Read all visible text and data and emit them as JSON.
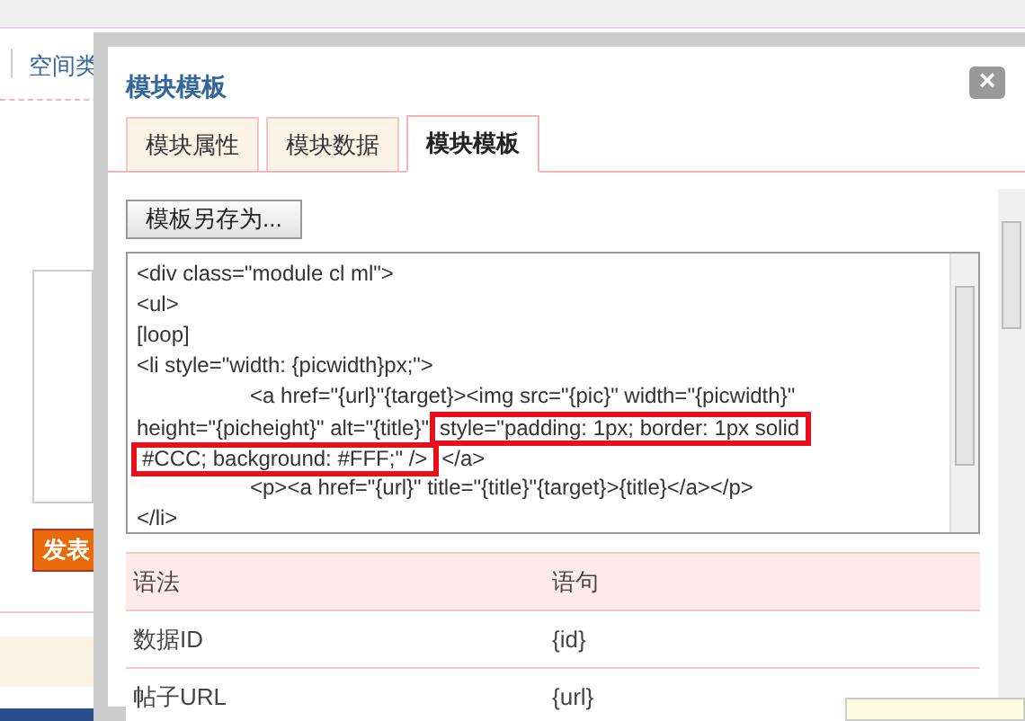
{
  "background_page": {
    "nav_link": "空间类",
    "button": "发表"
  },
  "dialog": {
    "title": "模块模板",
    "close": "×",
    "tabs": [
      {
        "label": "模块属性",
        "selected": false
      },
      {
        "label": "模块数据",
        "selected": false
      },
      {
        "label": "模块模板",
        "selected": true
      }
    ],
    "save_as_button": "模板另存为...",
    "code_lines": [
      {
        "indented": false,
        "segments": [
          {
            "text": "<div class=\"module cl ml\">",
            "highlighted": false
          }
        ]
      },
      {
        "indented": false,
        "segments": [
          {
            "text": "<ul>",
            "highlighted": false
          }
        ]
      },
      {
        "indented": false,
        "segments": [
          {
            "text": "[loop]",
            "highlighted": false
          }
        ]
      },
      {
        "indented": false,
        "segments": [
          {
            "text": "<li style=\"width: {picwidth}px;\">",
            "highlighted": false
          }
        ]
      },
      {
        "indented": true,
        "segments": [
          {
            "text": "<a href=\"{url}\"{target}><img src=\"{pic}\" width=\"{picwidth}\"",
            "highlighted": false
          }
        ]
      },
      {
        "indented": false,
        "segments": [
          {
            "text": "height=\"{picheight}\" alt=\"{title}\"",
            "highlighted": false
          },
          {
            "text": "style=\"padding: 1px; border: 1px solid",
            "highlighted": true
          }
        ]
      },
      {
        "indented": false,
        "segments": [
          {
            "text": "#CCC; background: #FFF;\" />",
            "highlighted": true
          },
          {
            "text": "</a>",
            "highlighted": false
          }
        ]
      },
      {
        "indented": true,
        "segments": [
          {
            "text": "<p><a href=\"{url}\" title=\"{title}\"{target}>{title}</a></p>",
            "highlighted": false
          }
        ]
      },
      {
        "indented": false,
        "segments": [
          {
            "text": "</li>",
            "highlighted": false
          }
        ]
      }
    ],
    "table": {
      "columns": [
        "语法",
        "语句"
      ],
      "rows": [
        [
          "数据ID",
          "{id}"
        ],
        [
          "帖子URL",
          "{url}"
        ]
      ]
    }
  }
}
